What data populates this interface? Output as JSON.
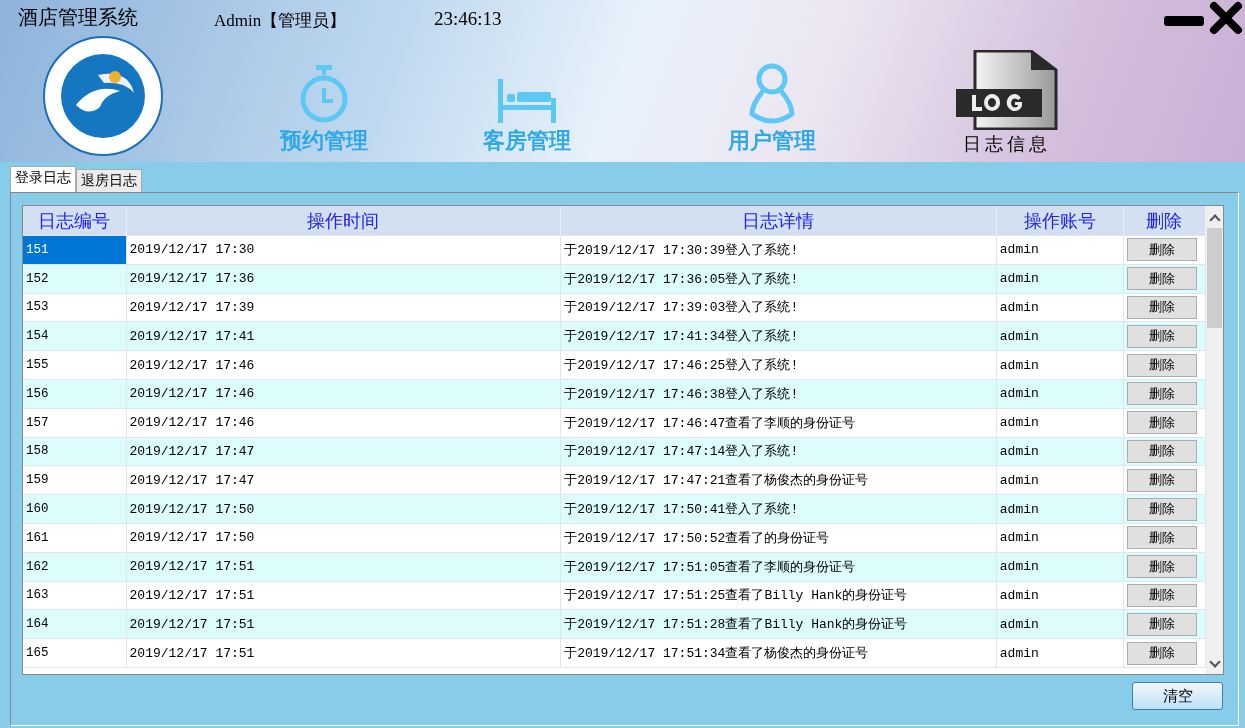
{
  "window": {
    "title": "酒店管理系统",
    "user": "Admin【管理员】",
    "clock": "23:46:13"
  },
  "nav": [
    {
      "label": "预约管理",
      "selected": false
    },
    {
      "label": "客房管理",
      "selected": false
    },
    {
      "label": "用户管理",
      "selected": false
    },
    {
      "label": "日志信息",
      "selected": true
    }
  ],
  "tabs": [
    {
      "label": "登录日志",
      "selected": true
    },
    {
      "label": "退房日志",
      "selected": false
    }
  ],
  "table": {
    "columns": [
      "日志编号",
      "操作时间",
      "日志详情",
      "操作账号",
      "删除"
    ],
    "rows": [
      {
        "id": "151",
        "time": "2019/12/17 17:30",
        "detail": "于2019/12/17 17:30:39登入了系统!",
        "account": "admin",
        "action": "删除",
        "selected": true
      },
      {
        "id": "152",
        "time": "2019/12/17 17:36",
        "detail": "于2019/12/17 17:36:05登入了系统!",
        "account": "admin",
        "action": "删除",
        "selected": false
      },
      {
        "id": "153",
        "time": "2019/12/17 17:39",
        "detail": "于2019/12/17 17:39:03登入了系统!",
        "account": "admin",
        "action": "删除",
        "selected": false
      },
      {
        "id": "154",
        "time": "2019/12/17 17:41",
        "detail": "于2019/12/17 17:41:34登入了系统!",
        "account": "admin",
        "action": "删除",
        "selected": false
      },
      {
        "id": "155",
        "time": "2019/12/17 17:46",
        "detail": "于2019/12/17 17:46:25登入了系统!",
        "account": "admin",
        "action": "删除",
        "selected": false
      },
      {
        "id": "156",
        "time": "2019/12/17 17:46",
        "detail": "于2019/12/17 17:46:38登入了系统!",
        "account": "admin",
        "action": "删除",
        "selected": false
      },
      {
        "id": "157",
        "time": "2019/12/17 17:46",
        "detail": "于2019/12/17 17:46:47查看了李顺的身份证号",
        "account": "admin",
        "action": "删除",
        "selected": false
      },
      {
        "id": "158",
        "time": "2019/12/17 17:47",
        "detail": "于2019/12/17 17:47:14登入了系统!",
        "account": "admin",
        "action": "删除",
        "selected": false
      },
      {
        "id": "159",
        "time": "2019/12/17 17:47",
        "detail": "于2019/12/17 17:47:21查看了杨俊杰的身份证号",
        "account": "admin",
        "action": "删除",
        "selected": false
      },
      {
        "id": "160",
        "time": "2019/12/17 17:50",
        "detail": "于2019/12/17 17:50:41登入了系统!",
        "account": "admin",
        "action": "删除",
        "selected": false
      },
      {
        "id": "161",
        "time": "2019/12/17 17:50",
        "detail": "于2019/12/17 17:50:52查看了的身份证号",
        "account": "admin",
        "action": "删除",
        "selected": false
      },
      {
        "id": "162",
        "time": "2019/12/17 17:51",
        "detail": "于2019/12/17 17:51:05查看了李顺的身份证号",
        "account": "admin",
        "action": "删除",
        "selected": false
      },
      {
        "id": "163",
        "time": "2019/12/17 17:51",
        "detail": "于2019/12/17 17:51:25查看了Billy Hank的身份证号",
        "account": "admin",
        "action": "删除",
        "selected": false
      },
      {
        "id": "164",
        "time": "2019/12/17 17:51",
        "detail": "于2019/12/17 17:51:28查看了Billy Hank的身份证号",
        "account": "admin",
        "action": "删除",
        "selected": false
      },
      {
        "id": "165",
        "time": "2019/12/17 17:51",
        "detail": "于2019/12/17 17:51:34查看了杨俊杰的身份证号",
        "account": "admin",
        "action": "删除",
        "selected": false
      }
    ]
  },
  "clear_button": "清空"
}
